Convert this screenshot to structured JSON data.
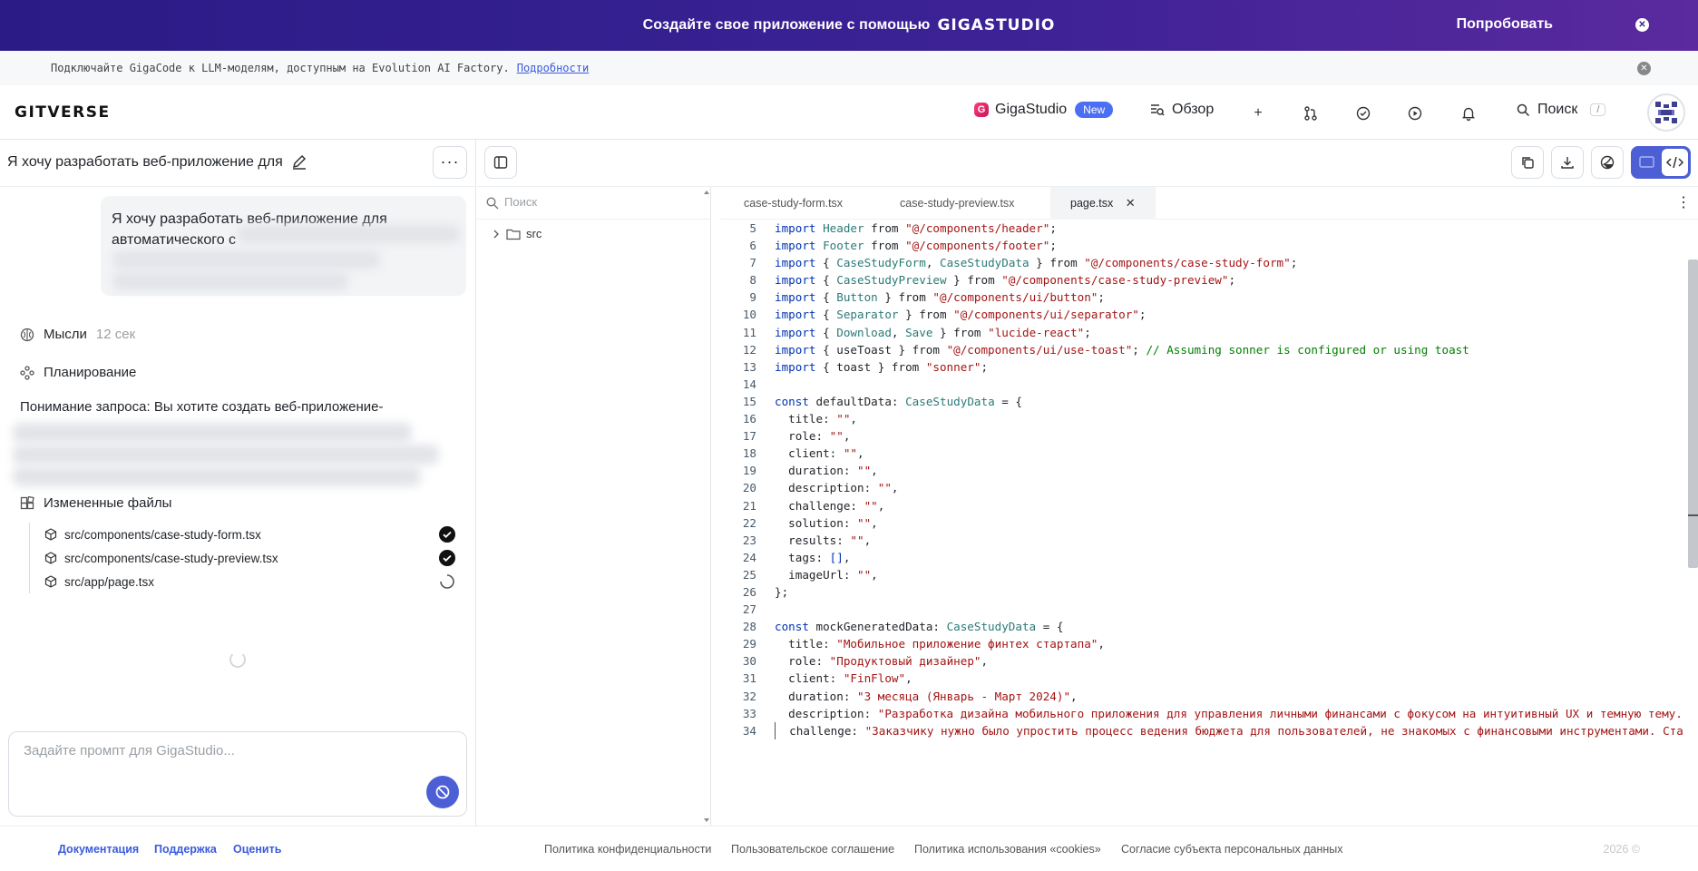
{
  "promo": {
    "text": "Создайте свое приложение с помощью",
    "brand": "GIGASTUDIO",
    "cta": "Попробовать"
  },
  "infobar": {
    "text": "Подключайте GigaCode к LLM-моделям, доступным на Evolution AI Factory.",
    "link": "Подробности"
  },
  "nav": {
    "logo": "GITVERSE",
    "gigastudio": "GigaStudio",
    "badge": "New",
    "overview": "Обзор",
    "search": "Поиск",
    "search_kbd": "/"
  },
  "chat": {
    "title": "Я хочу разработать веб-приложение для",
    "user_message_line1": "Я хочу разработать веб-приложение для",
    "user_message_line2": "автоматического с",
    "thoughts_label": "Мысли",
    "thoughts_time": "12 сек",
    "planning_label": "Планирование",
    "understanding": "Понимание запроса: Вы хотите создать веб-приложение-",
    "changed_files_label": "Измененные файлы",
    "files": [
      {
        "path": "src/components/case-study-form.tsx",
        "status": "done"
      },
      {
        "path": "src/components/case-study-preview.tsx",
        "status": "done"
      },
      {
        "path": "src/app/page.tsx",
        "status": "loading"
      }
    ],
    "prompt_placeholder": "Задайте промпт для GigaStudio..."
  },
  "filetree": {
    "search_placeholder": "Поиск",
    "root_folder": "src"
  },
  "editor": {
    "tabs": [
      {
        "label": "case-study-form.tsx",
        "active": false
      },
      {
        "label": "case-study-preview.tsx",
        "active": false
      },
      {
        "label": "page.tsx",
        "active": true
      }
    ],
    "lines": [
      {
        "n": "5",
        "t": [
          [
            "kw",
            "import "
          ],
          [
            "ty",
            "Header"
          ],
          [
            "ident",
            " from "
          ],
          [
            "st",
            "\"@/components/header\""
          ],
          [
            "ident",
            ";"
          ]
        ]
      },
      {
        "n": "6",
        "t": [
          [
            "kw",
            "import "
          ],
          [
            "ty",
            "Footer"
          ],
          [
            "ident",
            " from "
          ],
          [
            "st",
            "\"@/components/footer\""
          ],
          [
            "ident",
            ";"
          ]
        ]
      },
      {
        "n": "7",
        "t": [
          [
            "kw",
            "import "
          ],
          [
            "ident",
            "{ "
          ],
          [
            "ty",
            "CaseStudyForm"
          ],
          [
            "ident",
            ", "
          ],
          [
            "ty",
            "CaseStudyData"
          ],
          [
            "ident",
            " } from "
          ],
          [
            "st",
            "\"@/components/case-study-form\""
          ],
          [
            "ident",
            ";"
          ]
        ]
      },
      {
        "n": "8",
        "t": [
          [
            "kw",
            "import "
          ],
          [
            "ident",
            "{ "
          ],
          [
            "ty",
            "CaseStudyPreview"
          ],
          [
            "ident",
            " } from "
          ],
          [
            "st",
            "\"@/components/case-study-preview\""
          ],
          [
            "ident",
            ";"
          ]
        ]
      },
      {
        "n": "9",
        "t": [
          [
            "kw",
            "import "
          ],
          [
            "ident",
            "{ "
          ],
          [
            "ty",
            "Button"
          ],
          [
            "ident",
            " } from "
          ],
          [
            "st",
            "\"@/components/ui/button\""
          ],
          [
            "ident",
            ";"
          ]
        ]
      },
      {
        "n": "10",
        "t": [
          [
            "kw",
            "import "
          ],
          [
            "ident",
            "{ "
          ],
          [
            "ty",
            "Separator"
          ],
          [
            "ident",
            " } from "
          ],
          [
            "st",
            "\"@/components/ui/separator\""
          ],
          [
            "ident",
            ";"
          ]
        ]
      },
      {
        "n": "11",
        "t": [
          [
            "kw",
            "import "
          ],
          [
            "ident",
            "{ "
          ],
          [
            "ty",
            "Download"
          ],
          [
            "ident",
            ", "
          ],
          [
            "ty",
            "Save"
          ],
          [
            "ident",
            " } from "
          ],
          [
            "st",
            "\"lucide-react\""
          ],
          [
            "ident",
            ";"
          ]
        ]
      },
      {
        "n": "12",
        "t": [
          [
            "kw",
            "import "
          ],
          [
            "ident",
            "{ useToast } from "
          ],
          [
            "st",
            "\"@/components/ui/use-toast\""
          ],
          [
            "ident",
            "; "
          ],
          [
            "cm",
            "// Assuming sonner is configured or using toast"
          ]
        ]
      },
      {
        "n": "13",
        "t": [
          [
            "kw",
            "import "
          ],
          [
            "ident",
            "{ toast } from "
          ],
          [
            "st",
            "\"sonner\""
          ],
          [
            "ident",
            ";"
          ]
        ]
      },
      {
        "n": "14",
        "t": []
      },
      {
        "n": "15",
        "t": [
          [
            "kw",
            "const "
          ],
          [
            "ident",
            "defaultData: "
          ],
          [
            "ty",
            "CaseStudyData"
          ],
          [
            "ident",
            " = {"
          ]
        ]
      },
      {
        "n": "16",
        "t": [
          [
            "ident",
            "  title: "
          ],
          [
            "st",
            "\"\""
          ],
          [
            "ident",
            ","
          ]
        ]
      },
      {
        "n": "17",
        "t": [
          [
            "ident",
            "  role: "
          ],
          [
            "st",
            "\"\""
          ],
          [
            "ident",
            ","
          ]
        ]
      },
      {
        "n": "18",
        "t": [
          [
            "ident",
            "  client: "
          ],
          [
            "st",
            "\"\""
          ],
          [
            "ident",
            ","
          ]
        ]
      },
      {
        "n": "19",
        "t": [
          [
            "ident",
            "  duration: "
          ],
          [
            "st",
            "\"\""
          ],
          [
            "ident",
            ","
          ]
        ]
      },
      {
        "n": "20",
        "t": [
          [
            "ident",
            "  description: "
          ],
          [
            "st",
            "\"\""
          ],
          [
            "ident",
            ","
          ]
        ]
      },
      {
        "n": "21",
        "t": [
          [
            "ident",
            "  challenge: "
          ],
          [
            "st",
            "\"\""
          ],
          [
            "ident",
            ","
          ]
        ]
      },
      {
        "n": "22",
        "t": [
          [
            "ident",
            "  solution: "
          ],
          [
            "st",
            "\"\""
          ],
          [
            "ident",
            ","
          ]
        ]
      },
      {
        "n": "23",
        "t": [
          [
            "ident",
            "  results: "
          ],
          [
            "st",
            "\"\""
          ],
          [
            "ident",
            ","
          ]
        ]
      },
      {
        "n": "24",
        "t": [
          [
            "ident",
            "  tags: "
          ],
          [
            "kw",
            "[]"
          ],
          [
            "ident",
            ","
          ]
        ]
      },
      {
        "n": "25",
        "t": [
          [
            "ident",
            "  imageUrl: "
          ],
          [
            "st",
            "\"\""
          ],
          [
            "ident",
            ","
          ]
        ]
      },
      {
        "n": "26",
        "t": [
          [
            "ident",
            "};"
          ]
        ]
      },
      {
        "n": "27",
        "t": []
      },
      {
        "n": "28",
        "t": [
          [
            "kw",
            "const "
          ],
          [
            "ident",
            "mockGeneratedData: "
          ],
          [
            "ty",
            "CaseStudyData"
          ],
          [
            "ident",
            " = {"
          ]
        ]
      },
      {
        "n": "29",
        "t": [
          [
            "ident",
            "  title: "
          ],
          [
            "st",
            "\"Мобильное приложение финтех стартапа\""
          ],
          [
            "ident",
            ","
          ]
        ]
      },
      {
        "n": "30",
        "t": [
          [
            "ident",
            "  role: "
          ],
          [
            "st",
            "\"Продуктовый дизайнер\""
          ],
          [
            "ident",
            ","
          ]
        ]
      },
      {
        "n": "31",
        "t": [
          [
            "ident",
            "  client: "
          ],
          [
            "st",
            "\"FinFlow\""
          ],
          [
            "ident",
            ","
          ]
        ]
      },
      {
        "n": "32",
        "t": [
          [
            "ident",
            "  duration: "
          ],
          [
            "st",
            "\"3 месяца (Январь - Март 2024)\""
          ],
          [
            "ident",
            ","
          ]
        ]
      },
      {
        "n": "33",
        "t": [
          [
            "ident",
            "  description: "
          ],
          [
            "st",
            "\"Разработка дизайна мобильного приложения для управления личными финансами с фокусом на интуитивный UX и темную тему."
          ]
        ]
      },
      {
        "n": "34",
        "t": [
          [
            "ident",
            "  challenge: "
          ],
          [
            "st",
            "\"Заказчику нужно было упростить процесс ведения бюджета для пользователей, не знакомых с финансовыми инструментами. Ста"
          ]
        ],
        "cur": true
      }
    ]
  },
  "footer": {
    "docs": "Документация",
    "support": "Поддержка",
    "rate": "Оценить",
    "privacy": "Политика конфиденциальности",
    "agreement": "Пользовательское соглашение",
    "cookies": "Политика использования «cookies»",
    "consent": "Согласие субъекта персональных данных",
    "copyright": "2026 ©"
  }
}
